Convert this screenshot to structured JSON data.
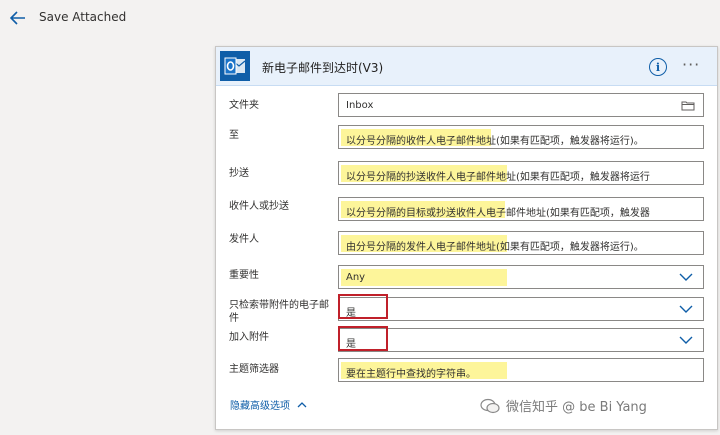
{
  "header": {
    "back_icon": "arrow-left-icon",
    "title": "Save Attached"
  },
  "card": {
    "title": "新电子邮件到达时(V3)",
    "app_icon": "outlook-icon",
    "info_label": "i",
    "more_label": "···"
  },
  "fields": {
    "folder": {
      "label": "文件夹",
      "value": "Inbox",
      "icon": "folder-icon"
    },
    "to": {
      "label": "至",
      "placeholder": "以分号分隔的收件人电子邮件地址(如果有匹配项，触发器将运行)。"
    },
    "cc": {
      "label": "抄送",
      "placeholder": "以分号分隔的抄送收件人电子邮件地址(如果有匹配项，触发器将运行"
    },
    "to_or_cc": {
      "label": "收件人或抄送",
      "placeholder": "以分号分隔的目标或抄送收件人电子邮件地址(如果有匹配项，触发器"
    },
    "from": {
      "label": "发件人",
      "placeholder": "由分号分隔的发件人电子邮件地址(如果有匹配项，触发器将运行)。"
    },
    "importance": {
      "label": "重要性",
      "value": "Any"
    },
    "only_with_attachments": {
      "label_line1": "只检索带附件的电子邮",
      "label_line2": "件",
      "value": "是"
    },
    "include_attachments": {
      "label": "加入附件",
      "value": "是"
    },
    "subject_filter": {
      "label": "主题筛选器",
      "placeholder": "要在主题行中查找的字符串。"
    }
  },
  "footer": {
    "hide_advanced": "隐藏高级选项",
    "watermark": "微信知乎 @ be Bi Yang"
  },
  "colors": {
    "accent": "#0f5ea8",
    "highlight": "#fdf59a",
    "annotation_red": "#c0202a"
  }
}
